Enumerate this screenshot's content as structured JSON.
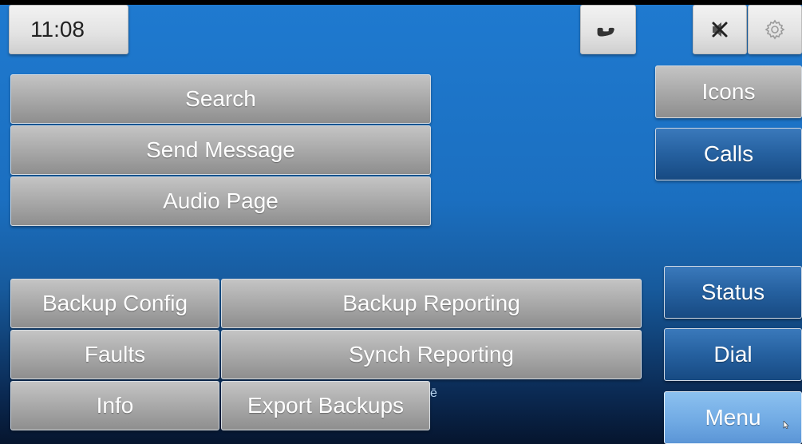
{
  "status_bar": {
    "time": "11:08",
    "icons": {
      "phone": "phone-icon",
      "mute": "speaker-muted-icon",
      "settings": "gear-icon"
    }
  },
  "main_menu": {
    "search_label": "Search",
    "send_message_label": "Send Message",
    "audio_page_label": "Audio Page"
  },
  "function_grid": {
    "backup_config_label": "Backup Config",
    "backup_reporting_label": "Backup Reporting",
    "faults_label": "Faults",
    "synch_reporting_label": "Synch Reporting",
    "info_label": "Info",
    "export_backups_label": "Export Backups"
  },
  "side_nav": {
    "icons_label": "Icons",
    "calls_label": "Calls",
    "status_label": "Status",
    "dial_label": "Dial",
    "menu_label": "Menu"
  },
  "colors": {
    "background": "#1b6fc0",
    "gray_button": "#a9a9a9",
    "blue_button": "#25609f",
    "active_button": "#6fa9e3"
  }
}
